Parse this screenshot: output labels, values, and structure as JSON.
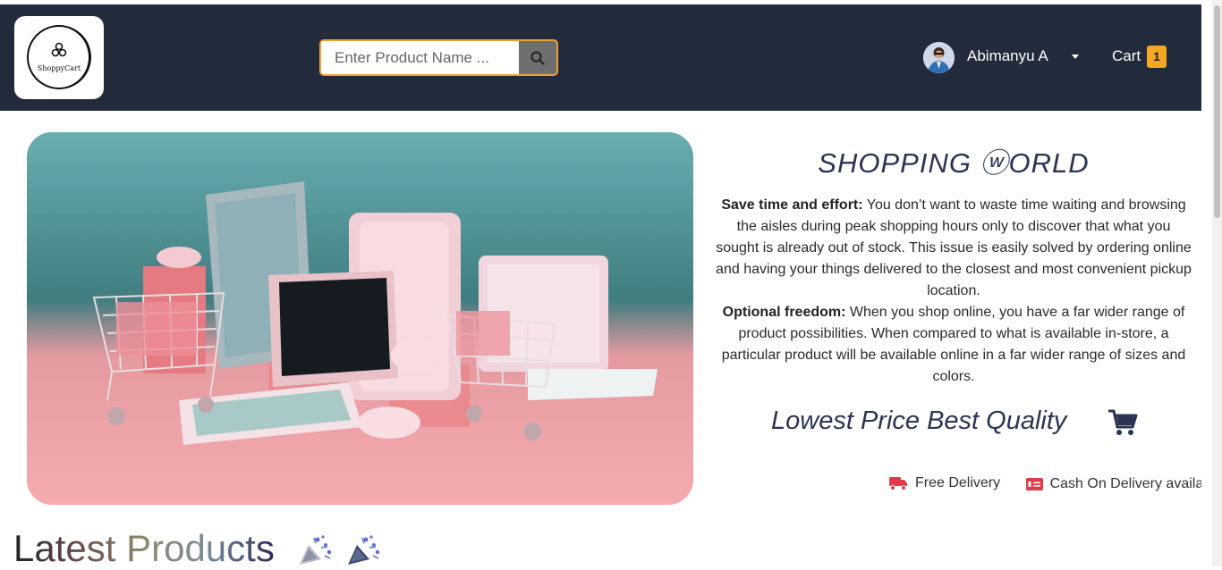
{
  "header": {
    "logo_text": "ShoppyCart",
    "search_placeholder": "Enter Product Name ...",
    "user_name": "Abimanyu A",
    "cart_label": "Cart",
    "cart_count": "1"
  },
  "info": {
    "title": "SHOPPING ⓦORLD",
    "p1_bold": "Save time and effort:",
    "p1_text": " You don’t want to waste time waiting and browsing the aisles during peak shopping hours only to discover that what you sought is already out of stock. This issue is easily solved by ordering online and having your things delivered to the closest and most convenient pickup location.",
    "p2_bold": "Optional freedom:",
    "p2_text": " When you shop online, you have a far wider range of product possibilities. When compared to what is available in-store, a particular product will be available online in a far wider range of sizes and colors.",
    "tagline": "Lowest Price Best Quality"
  },
  "features": [
    {
      "label": "Free Delivery",
      "icon": "truck-icon"
    },
    {
      "label": "Cash On Delivery available",
      "icon": "cash-icon"
    }
  ],
  "section": {
    "latest_title": "Latest Products"
  },
  "colors": {
    "navbar": "#222b3c",
    "accent": "#f5a623",
    "title": "#2b3452",
    "feature_icon": "#e03b4a"
  }
}
